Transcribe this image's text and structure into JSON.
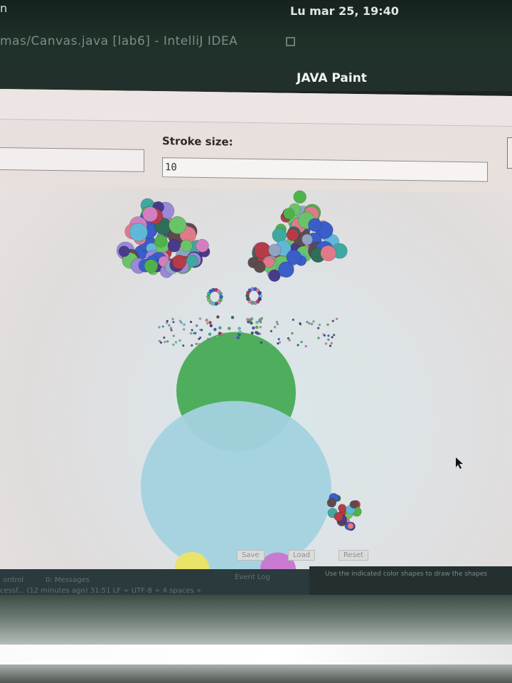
{
  "system_bar": {
    "menu_fragment": "n",
    "clock": "Lu mar 25, 19:40",
    "ide_title": "mas/Canvas.java [lab6] - IntelliJ IDEA"
  },
  "app": {
    "title": "JAVA Paint",
    "stroke_label": "Stroke size:",
    "stroke_value": "10",
    "left_field_value": "",
    "buttons": {
      "save": "Save",
      "load": "Load",
      "reset": "Reset"
    }
  },
  "status": {
    "tabs": [
      "ontrol",
      "0: Messages"
    ],
    "event_log": "Event Log",
    "line": "cessf... (12 minutes ago)   31:51   LF ÷   UTF-8 ÷   4 spaces ÷",
    "right_text": "Use the indicated color shapes to draw the shapes"
  },
  "drawing": {
    "colors": {
      "head": "#4fae5d",
      "body": "#9fd0dd",
      "left_foot": "#e9e36a",
      "right_foot": "#c97ad0",
      "accent_purple": "#4a3a8a",
      "accent_blue": "#3a5dc9",
      "accent_red": "#b53c47",
      "accent_teal": "#3fa8a0",
      "accent_green": "#4fb34a"
    }
  }
}
